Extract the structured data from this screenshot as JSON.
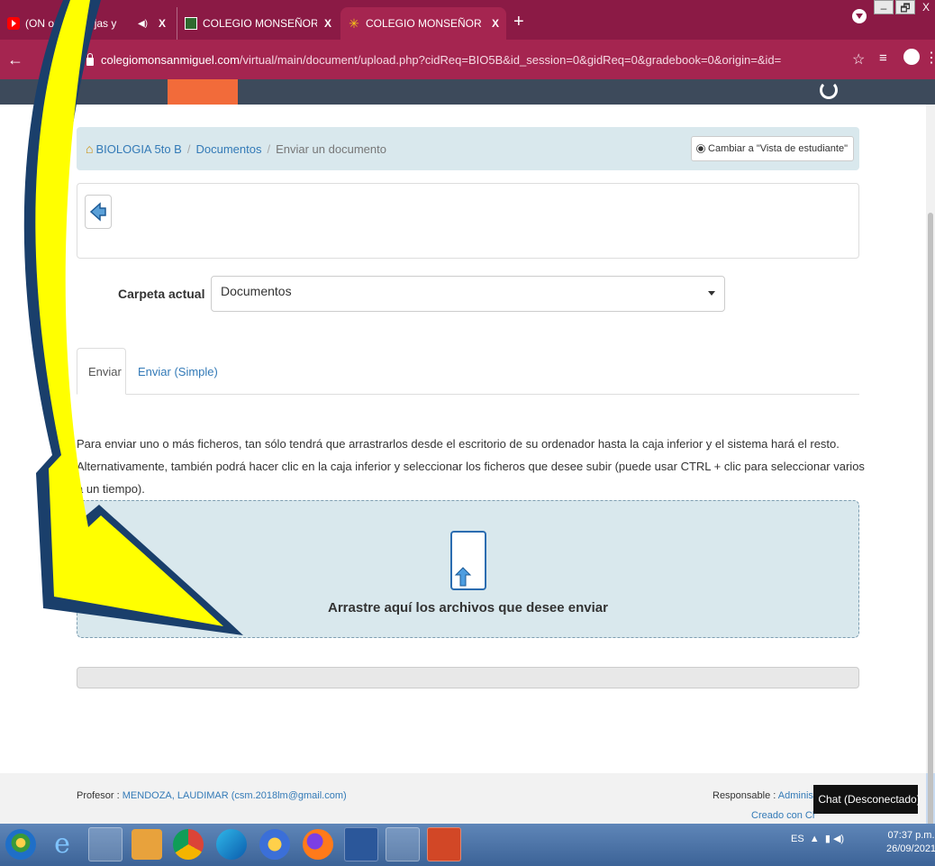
{
  "browser": {
    "tabs": [
      {
        "title": "(ON",
        "title2": "onald Borjas y",
        "icon": "youtube-icon"
      },
      {
        "title": "COLEGIO MONSEÑOR SANMIGU",
        "icon": "school-icon"
      },
      {
        "title": "COLEGIO MONSEÑOR SANMIGU",
        "icon": "star-icon",
        "active": true
      }
    ],
    "close_glyph": "X",
    "new_tab": "+",
    "url_domain": "colegiomonsanmiguel.com",
    "url_path": "/virtual/main/document/upload.php?cidReq=BIO5B&id_session=0&gidReq=0&gradebook=0&origin=&id=",
    "window_buttons": {
      "min": "–",
      "max": "🗗",
      "close": "X"
    }
  },
  "breadcrumb": {
    "course": "BIOLOGIA 5to B",
    "documents": "Documentos",
    "current": "Enviar un documento",
    "separator": "/"
  },
  "student_view_button": "Cambiar a \"Vista de estudiante\"",
  "folder": {
    "label": "Carpeta actual",
    "selected": "Documentos"
  },
  "tabs": {
    "enviar": "Enviar",
    "simple": "Enviar (Simple)"
  },
  "instructions": "Para enviar uno o más ficheros, tan sólo tendrá que arrastrarlos desde el escritorio de su ordenador hasta la caja inferior y el sistema hará el resto. Alternativamente, también podrá hacer clic en la caja inferior y seleccionar los ficheros que desee subir (puede usar CTRL + clic para seleccionar varios a un tiempo).",
  "dropzone": {
    "text": "Arrastre aquí los archivos que desee enviar"
  },
  "footer": {
    "teacher_label": "Profesor :",
    "teacher_name": "MENDOZA, LAUDIMAR (csm.2018lm@gmail.com)",
    "responsable_label": "Responsable :",
    "responsable_name": "Administra",
    "created": "Creado con Cha"
  },
  "chat": "Chat (Desconectado)",
  "taskbar": {
    "language": "ES",
    "time": "07:37 p.m.",
    "date": "26/09/2021"
  },
  "colors": {
    "tabbar": "#8b1a45",
    "breadcrumb_bg": "#d9e8ed",
    "link": "#337ab7",
    "annotation_fill": "#ffff00",
    "annotation_border": "#1a3f6b"
  }
}
